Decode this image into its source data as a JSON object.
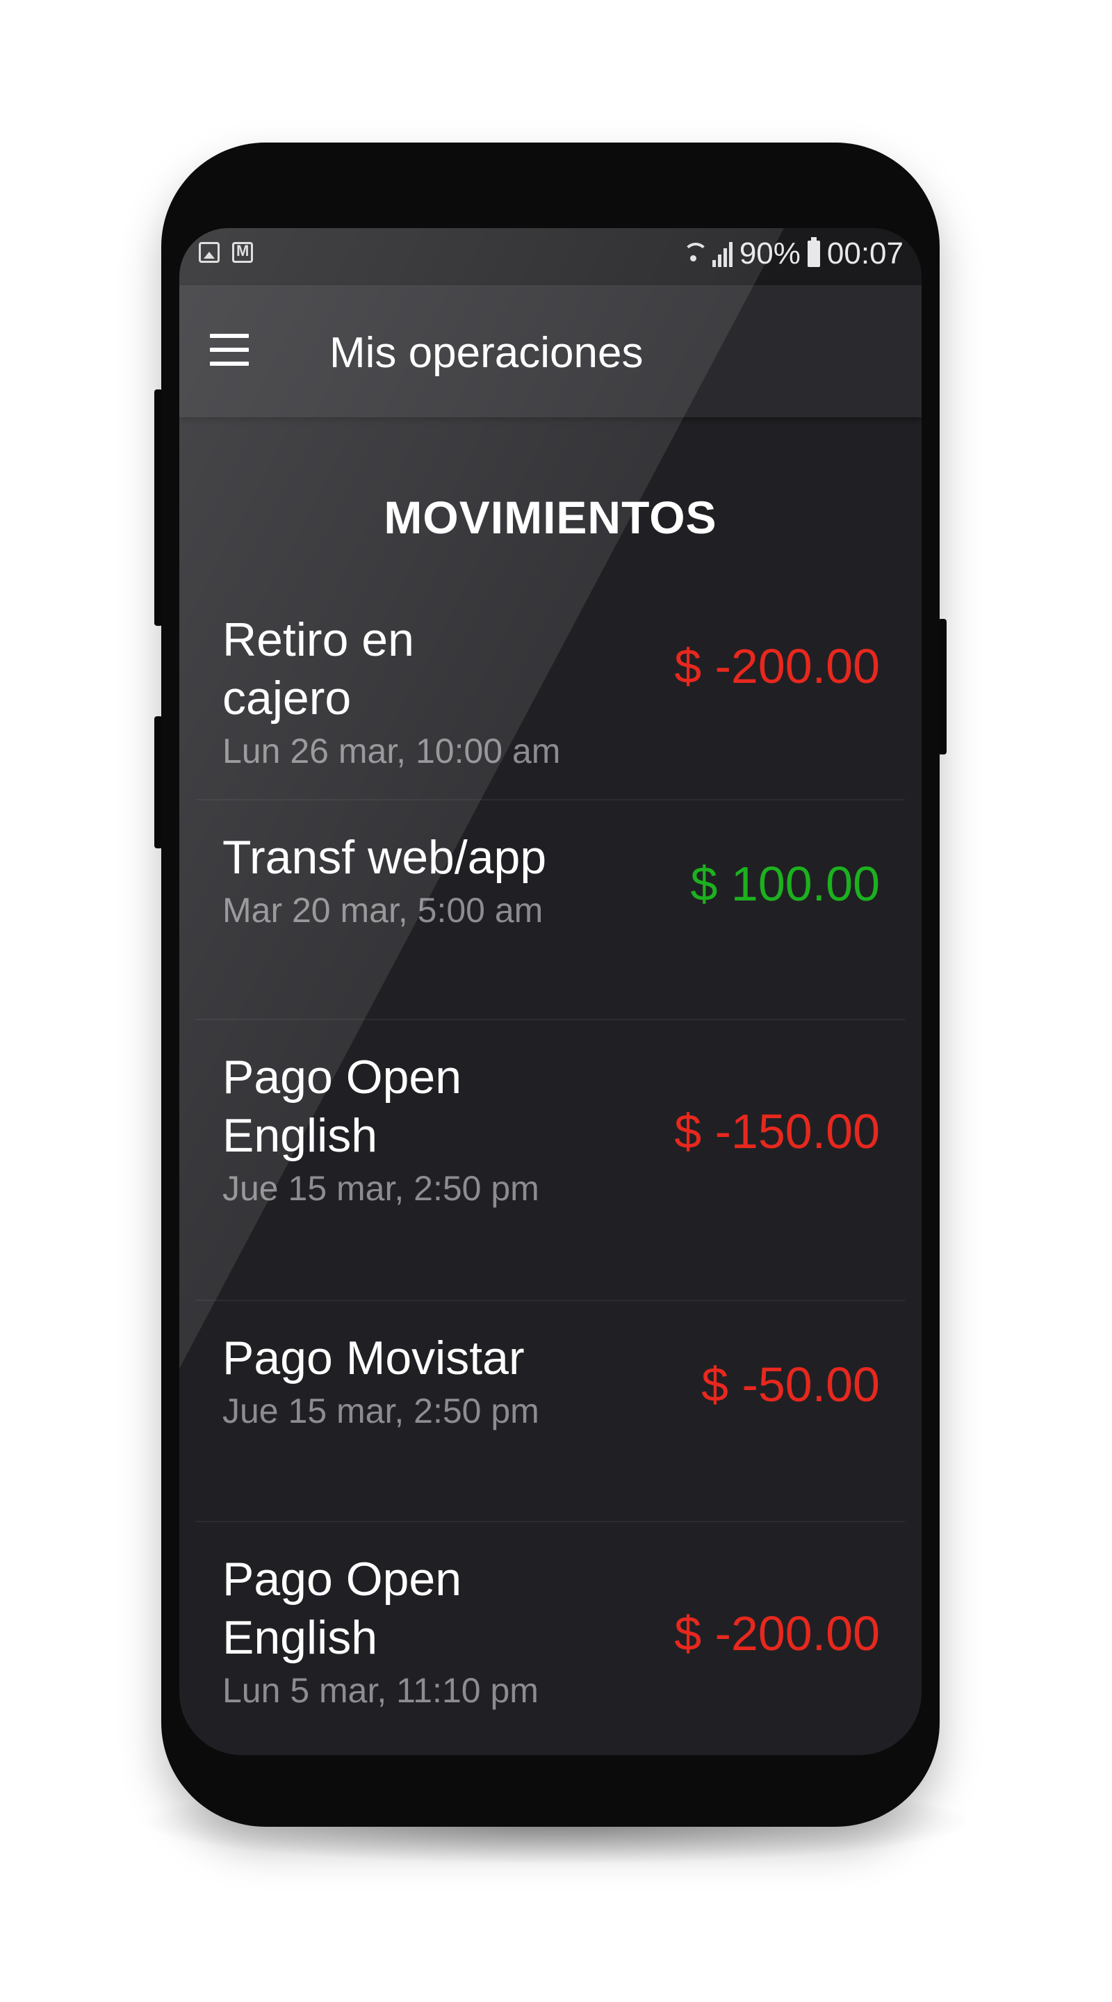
{
  "status_bar": {
    "battery": "90%",
    "time": "00:07",
    "icons": [
      "gallery-icon",
      "gmail-icon",
      "wifi-icon",
      "signal-icon",
      "battery-icon"
    ]
  },
  "app_bar": {
    "title": "Mis operaciones",
    "menu_icon": "hamburger-menu-icon"
  },
  "section_title": "MOVIMIENTOS",
  "colors": {
    "negative": "#e8281e",
    "positive": "#1cb11e",
    "background": "#202024"
  },
  "movements": [
    {
      "name": "Retiro en cajero",
      "date": "Lun 26 mar, 10:00 am",
      "amount": "$ -200.00",
      "type": "negative"
    },
    {
      "name": "Transf web/app",
      "date": "Mar 20 mar, 5:00 am",
      "amount": "$ 100.00",
      "type": "positive"
    },
    {
      "name": "Pago Open English",
      "date": "Jue 15 mar, 2:50 pm",
      "amount": "$ -150.00",
      "type": "negative"
    },
    {
      "name": "Pago Movistar",
      "date": "Jue 15 mar, 2:50 pm",
      "amount": "$ -50.00",
      "type": "negative"
    },
    {
      "name": "Pago Open English",
      "date": "Lun 5 mar, 11:10 pm",
      "amount": "$ -200.00",
      "type": "negative"
    }
  ]
}
